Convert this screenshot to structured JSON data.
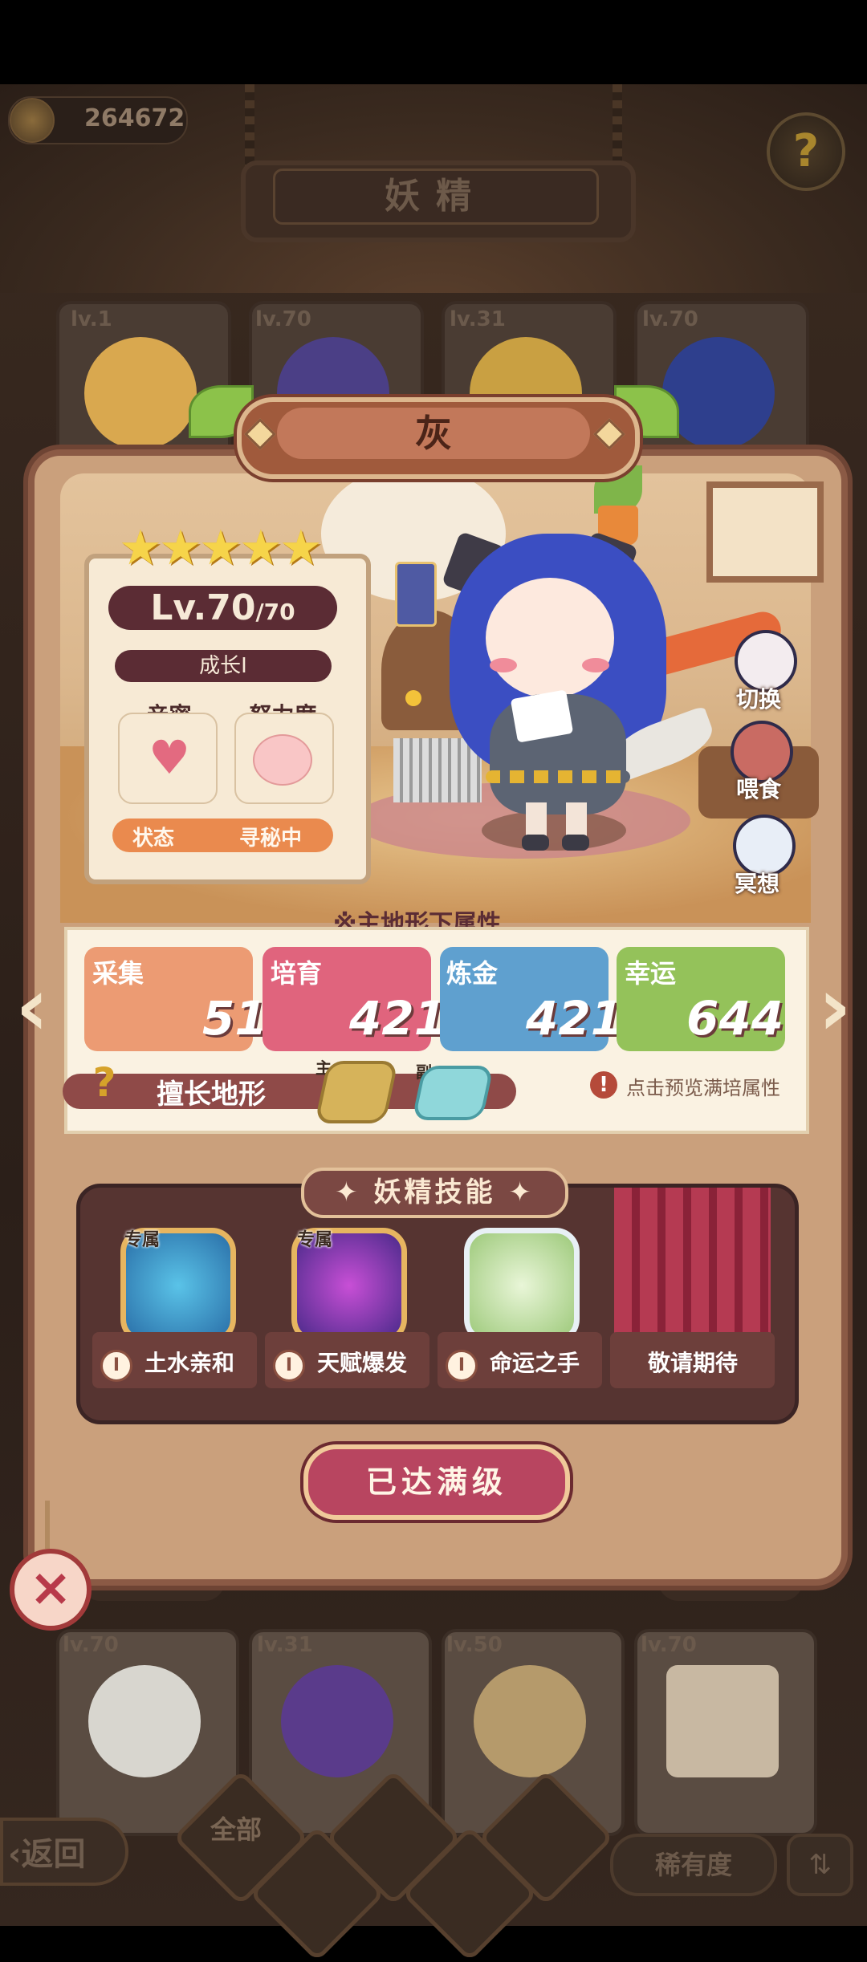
{
  "top_bar": {
    "coins": "264672",
    "help_icon": "question-mark"
  },
  "title": "妖精",
  "bg_cards_top": [
    {
      "level": "lv.1"
    },
    {
      "level": "lv.70"
    },
    {
      "level": "lv.31"
    },
    {
      "level": "lv.70"
    }
  ],
  "bg_cards_bottom": [
    {
      "level": "lv.70"
    },
    {
      "level": "lv.31"
    },
    {
      "level": "lv.50"
    },
    {
      "level": "lv.70"
    }
  ],
  "bottom_bar": {
    "back_label": "返回",
    "all_label": "全部",
    "rarity_label": "稀有度"
  },
  "fairy": {
    "name": "灰",
    "stars": 5,
    "level": "Lv.70",
    "max_level": "/70",
    "growth": "成长I",
    "intimacy_label": "亲密",
    "effort_label": "努力度",
    "status_label": "状态",
    "status_value": "寻秘中"
  },
  "side_actions": [
    {
      "label": "切换",
      "icon": "switch-icon"
    },
    {
      "label": "喂食",
      "icon": "meat-icon"
    },
    {
      "label": "冥想",
      "icon": "meditate-icon"
    }
  ],
  "attributes": {
    "header": "※主地形下属性",
    "items": [
      {
        "name": "采集",
        "value": "51",
        "color": "#ec9b73"
      },
      {
        "name": "培育",
        "value": "421",
        "color": "#e0647d"
      },
      {
        "name": "炼金",
        "value": "421",
        "color": "#5fa0cf"
      },
      {
        "name": "幸运",
        "value": "644",
        "color": "#94c25a"
      }
    ],
    "terrain_label": "擅长地形",
    "main_tag": "主",
    "sub_tag": "副",
    "preview_text": "点击预览满培属性",
    "warn_icon": "!"
  },
  "skills": {
    "title": "妖精技能",
    "items": [
      {
        "tag": "专属",
        "name": "土水亲和",
        "badge": "I",
        "icon": "swirl-icon"
      },
      {
        "tag": "专属",
        "name": "天赋爆发",
        "badge": "I",
        "icon": "burst-icon"
      },
      {
        "tag": "",
        "name": "命运之手",
        "badge": "I",
        "icon": "clover-icon"
      },
      {
        "tag": "",
        "name": "敬请期待",
        "badge": "",
        "icon": "curtain-icon"
      }
    ]
  },
  "max_button": "已达满级",
  "close_icon": "×"
}
